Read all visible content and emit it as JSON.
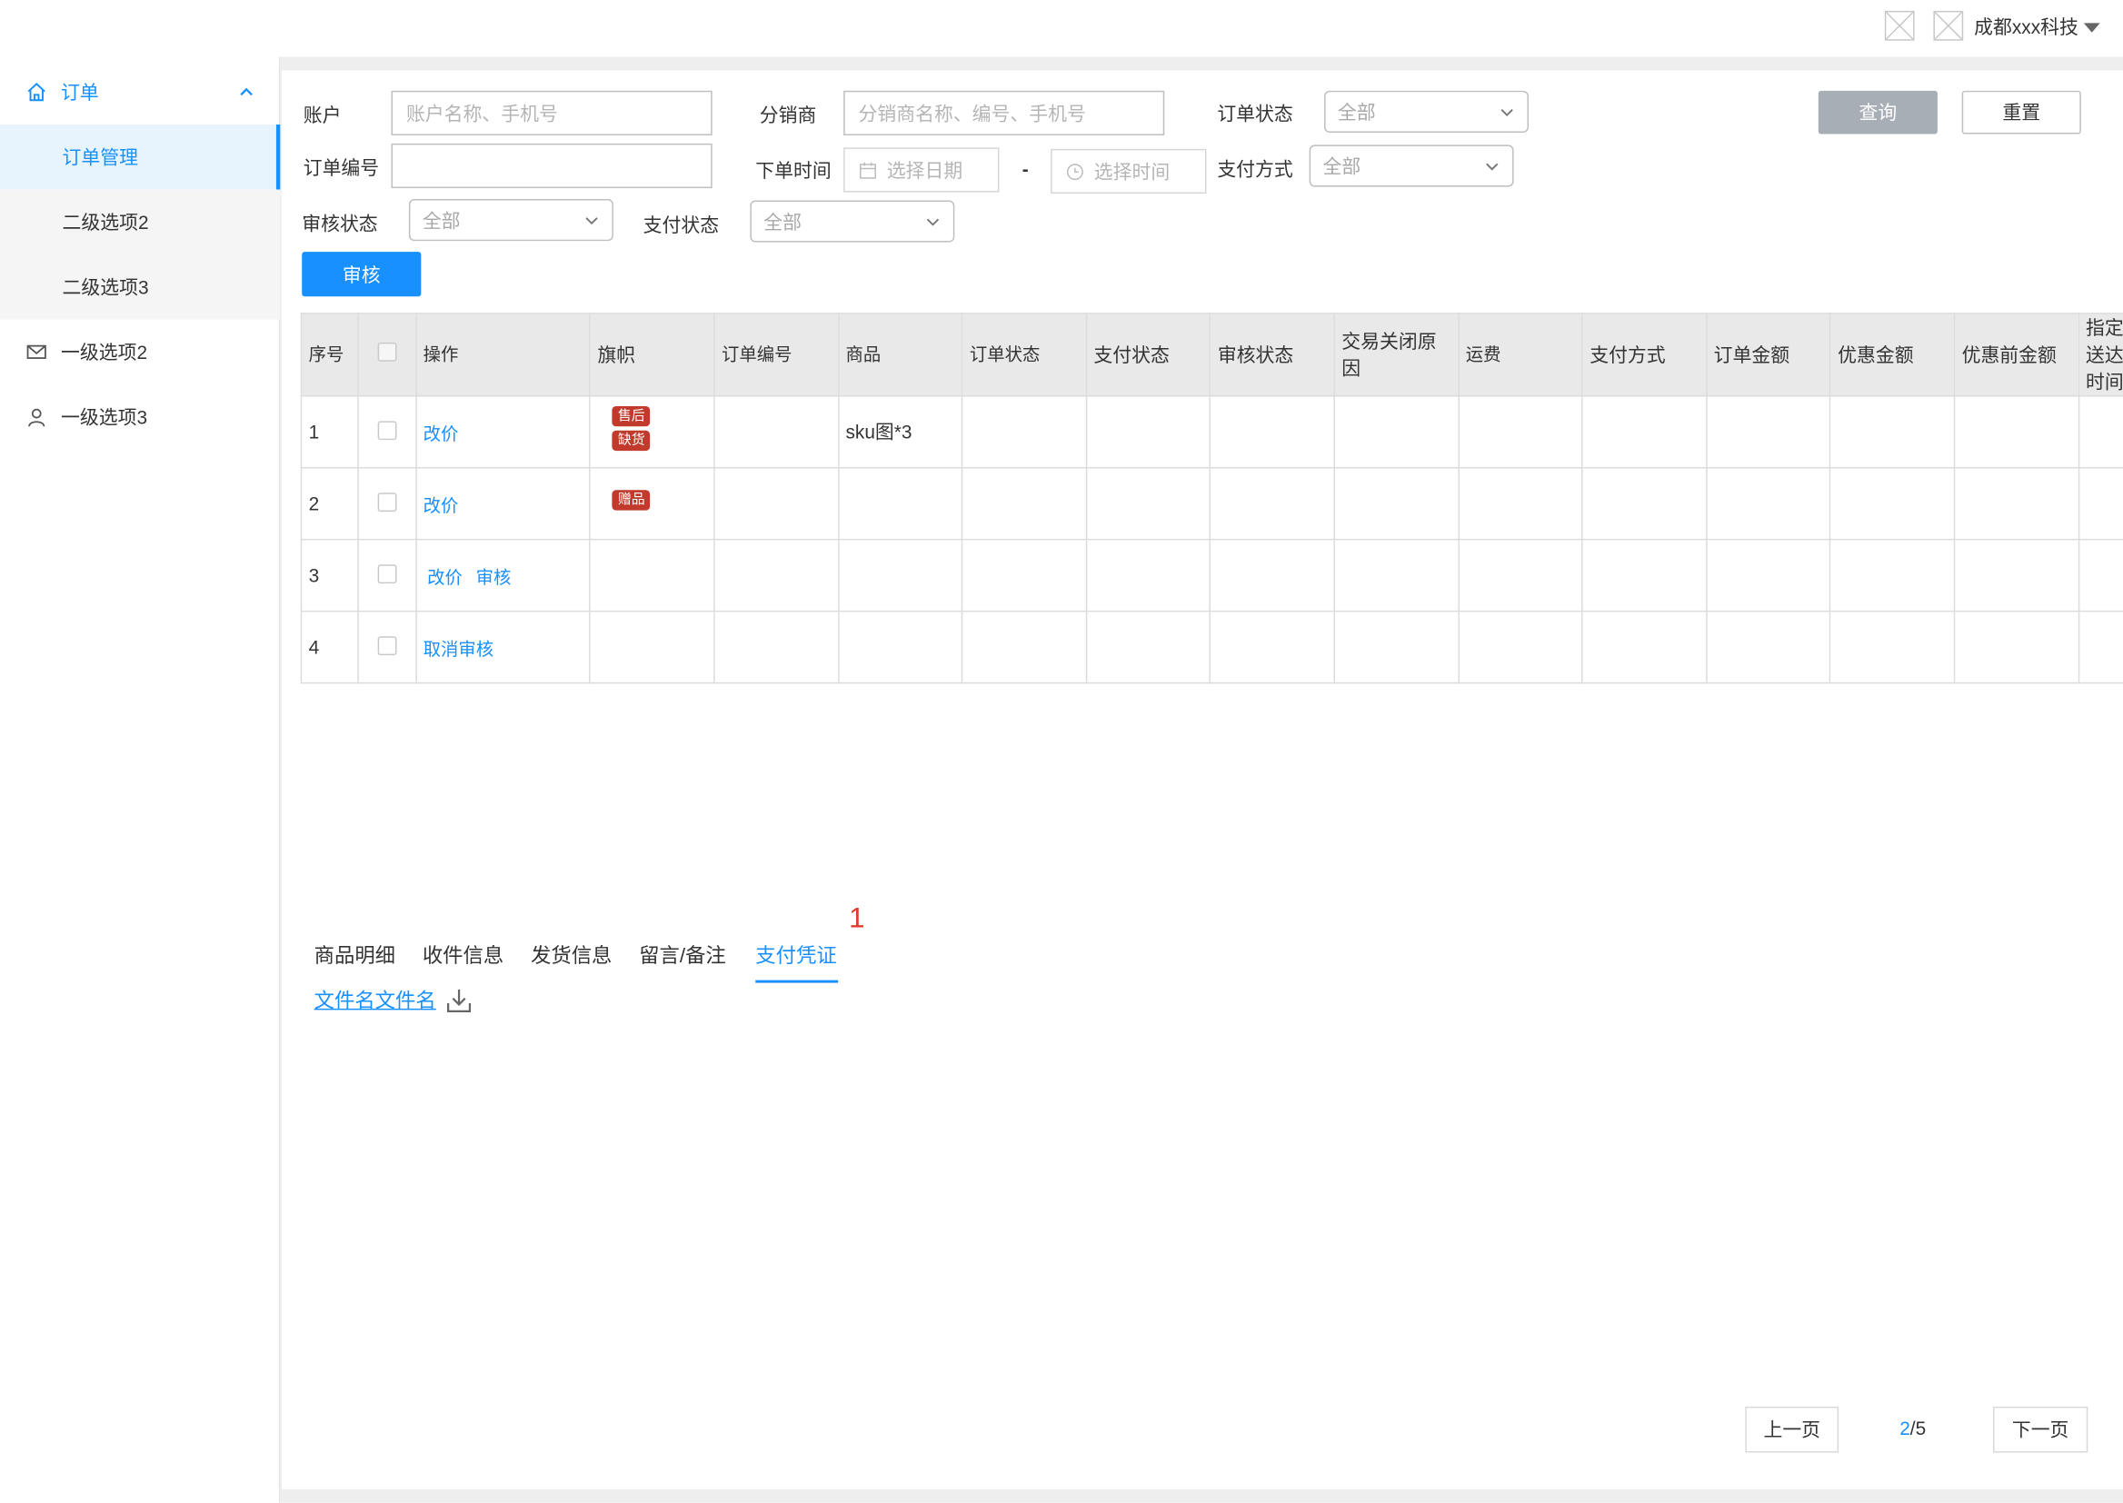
{
  "header": {
    "company": "成都xxx科技"
  },
  "sidebar": {
    "items": [
      {
        "label": "订单"
      },
      {
        "label": "订单管理"
      },
      {
        "label": "二级选项2"
      },
      {
        "label": "二级选项3"
      },
      {
        "label": "一级选项2"
      },
      {
        "label": "一级选项3"
      }
    ]
  },
  "filters": {
    "account_label": "账户",
    "account_placeholder": "账户名称、手机号",
    "distributor_label": "分销商",
    "distributor_placeholder": "分销商名称、编号、手机号",
    "order_status_label": "订单状态",
    "order_status_value": "全部",
    "order_no_label": "订单编号",
    "order_time_label": "下单时间",
    "date_placeholder": "选择日期",
    "date_sep": "-",
    "time_placeholder": "选择时间",
    "pay_method_label": "支付方式",
    "pay_method_value": "全部",
    "audit_status_label": "审核状态",
    "audit_status_value": "全部",
    "pay_status_label": "支付状态",
    "pay_status_value": "全部",
    "query_button": "查询",
    "reset_button": "重置",
    "audit_button": "审核"
  },
  "table": {
    "headers": {
      "seq": "序号",
      "op": "操作",
      "flag": "旗帜",
      "order_no": "订单编号",
      "product": "商品",
      "order_status": "订单状态",
      "pay_status": "支付状态",
      "audit_status": "审核状态",
      "close_reason": "交易关闭原因",
      "freight": "运费",
      "pay_method": "支付方式",
      "order_amount": "订单金额",
      "discount": "优惠金额",
      "pre_discount": "优惠前金额",
      "designated": "指定送达时间"
    },
    "rows": [
      {
        "seq": "1",
        "ops": [
          "改价"
        ],
        "tags": [
          "售后",
          "缺货"
        ],
        "product": "sku图*3"
      },
      {
        "seq": "2",
        "ops": [
          "改价"
        ],
        "tags": [
          "赠品"
        ],
        "product": ""
      },
      {
        "seq": "3",
        "ops": [
          "改价",
          "审核"
        ],
        "tags": [],
        "product": ""
      },
      {
        "seq": "4",
        "ops": [
          "取消审核"
        ],
        "tags": [],
        "product": ""
      }
    ]
  },
  "tabs": {
    "items": [
      "商品明细",
      "收件信息",
      "发货信息",
      "留言/备注",
      "支付凭证"
    ],
    "active_index": 4,
    "annotation": "1"
  },
  "attachment": {
    "filename": "文件名文件名"
  },
  "pagination": {
    "prev": "上一页",
    "current": "2",
    "total": "/5",
    "next": "下一页"
  },
  "colors": {
    "accent": "#1890ff",
    "tag": "#c23a2b",
    "query_button": "#a7aeb5",
    "annotation": "#e03c2d"
  }
}
